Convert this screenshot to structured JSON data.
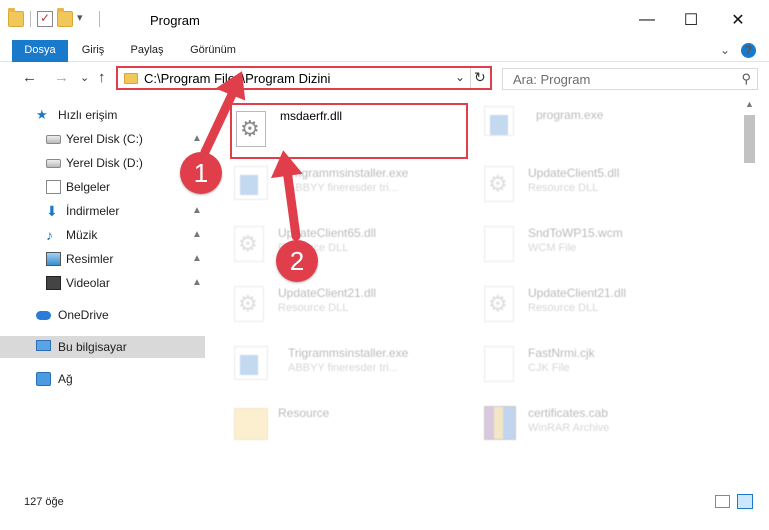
{
  "window": {
    "title": "Program",
    "controls": {
      "minimize": "—",
      "maximize": "☐",
      "close": "✕"
    }
  },
  "ribbon": {
    "tabs": [
      {
        "label": "Dosya",
        "active": true
      },
      {
        "label": "Giriş",
        "active": false
      },
      {
        "label": "Paylaş",
        "active": false
      },
      {
        "label": "Görünüm",
        "active": false
      }
    ],
    "expand_glyph": "⌄",
    "help_glyph": "?"
  },
  "nav": {
    "back": "←",
    "forward": "→",
    "recent": "⌄",
    "up": "↑",
    "address": "C:\\Program Files\\Program Dizini",
    "dropdown": "⌄",
    "refresh": "↻",
    "search_placeholder": "Ara: Program",
    "search_icon": "⚲"
  },
  "sidebar": {
    "items": [
      {
        "label": "Hızlı erişim",
        "icon": "star-icon",
        "pinned": false
      },
      {
        "label": "Yerel Disk (C:)",
        "icon": "drive-icon",
        "pinned": true
      },
      {
        "label": "Yerel Disk (D:)",
        "icon": "drive-icon",
        "pinned": false
      },
      {
        "label": "Belgeler",
        "icon": "document-icon",
        "pinned": false
      },
      {
        "label": "İndirmeler",
        "icon": "download-icon",
        "pinned": true
      },
      {
        "label": "Müzik",
        "icon": "music-icon",
        "pinned": true
      },
      {
        "label": "Resimler",
        "icon": "pictures-icon",
        "pinned": true
      },
      {
        "label": "Videolar",
        "icon": "videos-icon",
        "pinned": true
      },
      {
        "label": "OneDrive",
        "icon": "cloud-icon",
        "pinned": false
      },
      {
        "label": "Bu bilgisayar",
        "icon": "computer-icon",
        "pinned": false,
        "selected": true
      },
      {
        "label": "Ağ",
        "icon": "network-icon",
        "pinned": false
      }
    ],
    "pin_glyph": "📌"
  },
  "files": [
    {
      "name": "msdaerfr.dll",
      "type": "",
      "icon": "dll-icon",
      "highlighted": true
    },
    {
      "name": "program.exe",
      "type": "",
      "icon": "exe-icon"
    },
    {
      "name": "Trigrammsinstaller.exe",
      "type": "ABBYY fineresder tri...",
      "icon": "exe-icon"
    },
    {
      "name": "UpdateClient5.dll",
      "type": "Resource DLL",
      "icon": "dll-icon"
    },
    {
      "name": "UpdateClient65.dll",
      "type": "Resource DLL",
      "icon": "dll-icon"
    },
    {
      "name": "SndToWP15.wcm",
      "type": "WCM File",
      "icon": "text-icon"
    },
    {
      "name": "UpdateClient21.dll",
      "type": "Resource DLL",
      "icon": "dll-icon"
    },
    {
      "name": "UpdateClient21.dll",
      "type": "Resource DLL",
      "icon": "dll-icon"
    },
    {
      "name": "Trigrammsinstaller.exe",
      "type": "ABBYY fineresder tri...",
      "icon": "exe-icon"
    },
    {
      "name": "FastNrmi.cjk",
      "type": "CJK File",
      "icon": "text-icon"
    },
    {
      "name": "Resource",
      "type": "",
      "icon": "folder-icon"
    },
    {
      "name": "certificates.cab",
      "type": "WinRAR Archive",
      "icon": "archive-icon"
    }
  ],
  "annotations": {
    "step1": "1",
    "step2": "2",
    "color": "#e03e4b"
  },
  "status": {
    "item_count": "127 öğe"
  },
  "colors": {
    "accent": "#1979ca",
    "highlight": "#e03e4b",
    "selection": "#cce8ff"
  }
}
